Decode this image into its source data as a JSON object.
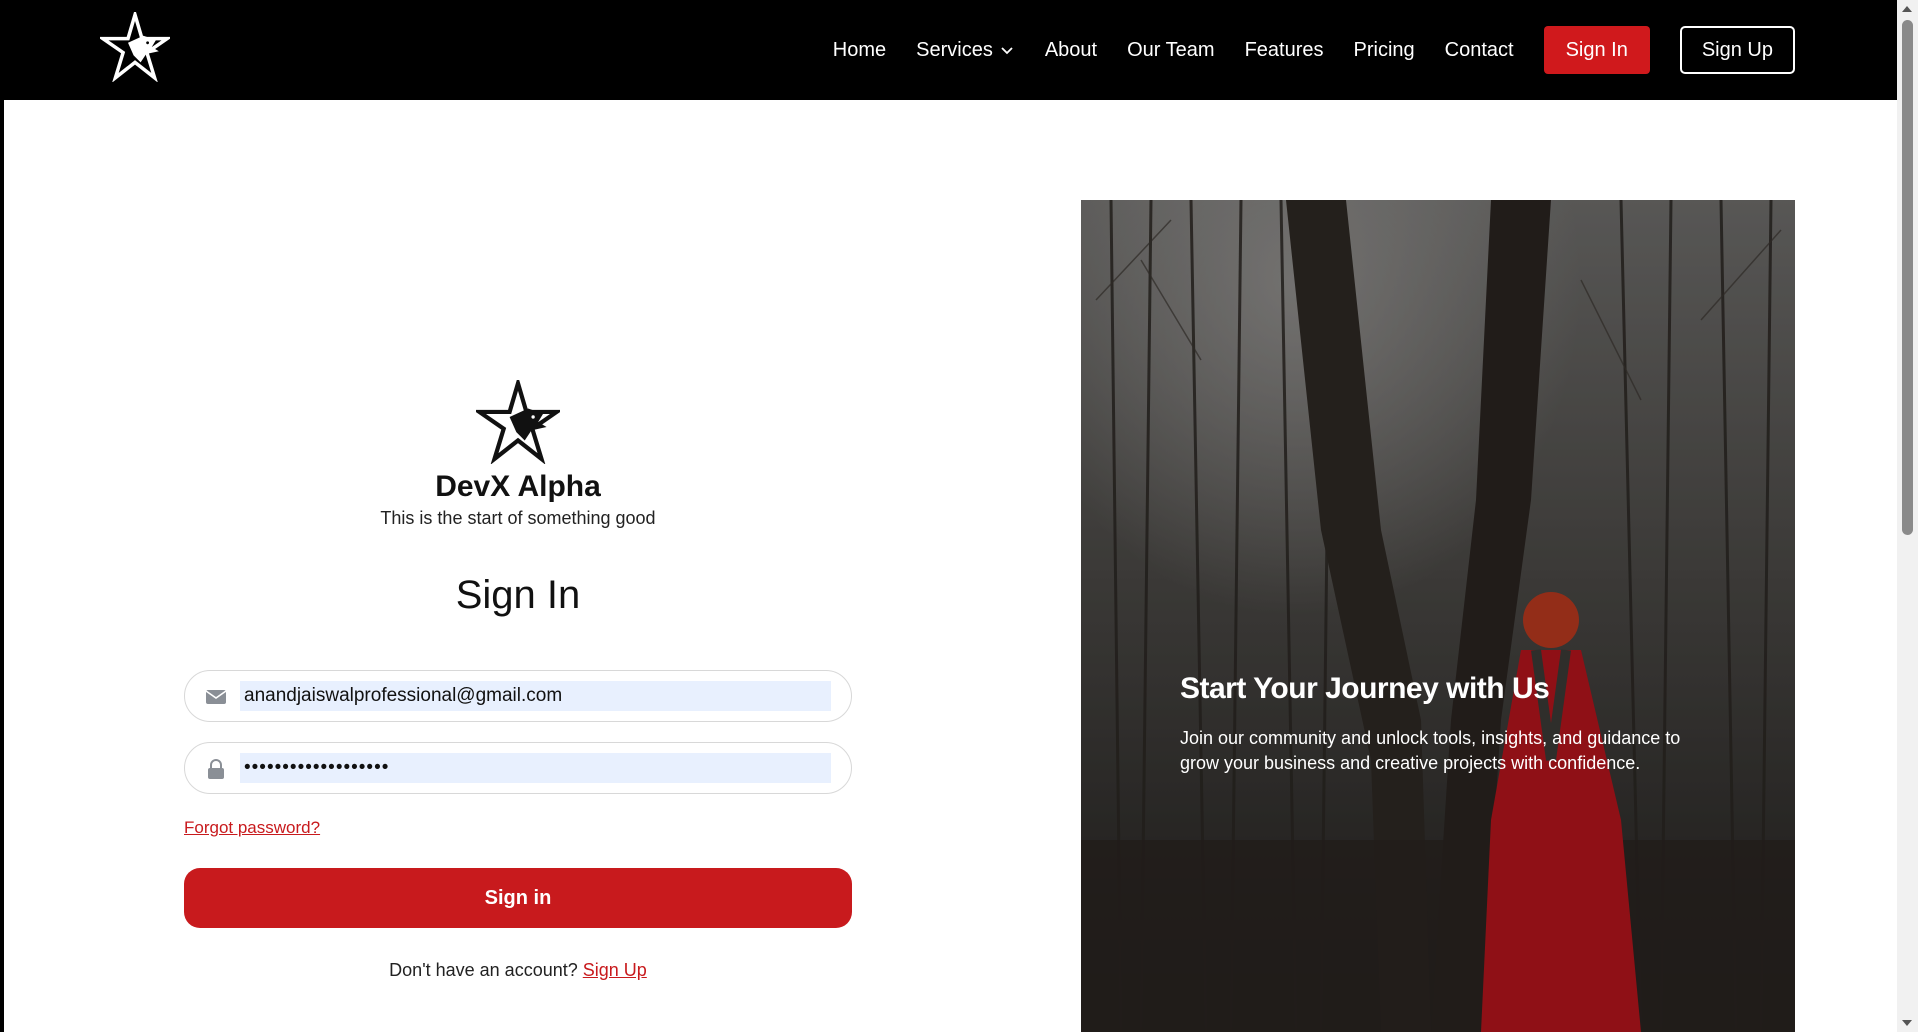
{
  "nav": {
    "links": [
      "Home",
      "Services",
      "About",
      "Our Team",
      "Features",
      "Pricing",
      "Contact"
    ],
    "signin_label": "Sign In",
    "signup_label": "Sign Up",
    "logo_icon": "star-wolf-logo-icon"
  },
  "form": {
    "brand_name": "DevX Alpha",
    "tagline": "This is the start of something good",
    "title": "Sign In",
    "email_value": "anandjaiswalprofessional@gmail.com",
    "email_icon": "envelope-icon",
    "password_mask": "•••••••••••••••••••",
    "password_icon": "lock-icon",
    "forgot_label": "Forgot password?",
    "submit_label": "Sign in",
    "no_account_text": "Don't have an account?",
    "signup_link": "Sign Up"
  },
  "hero": {
    "title": "Start Your Journey with Us",
    "description": "Join our community and unlock tools, insights, and guidance to grow your business and creative projects with confidence."
  },
  "colors": {
    "accent": "#c81a1d",
    "navbar": "#000000",
    "input_fill": "#e8f0fe"
  }
}
